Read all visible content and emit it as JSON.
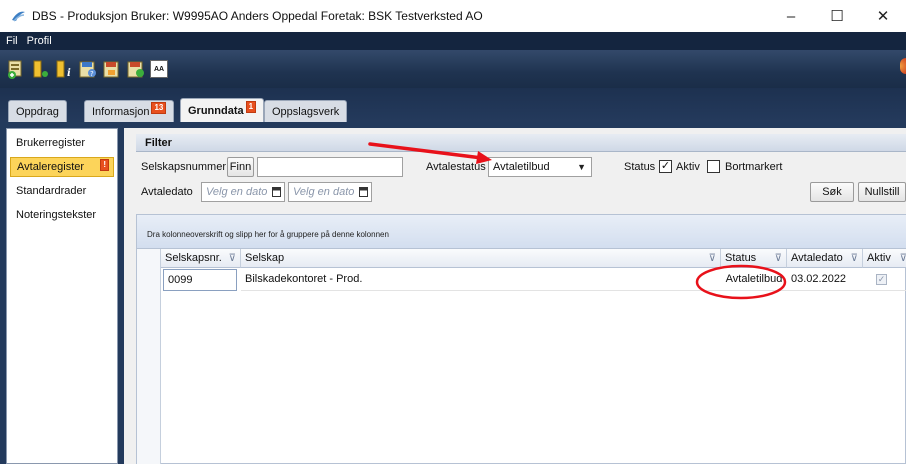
{
  "window": {
    "title": "DBS - Produksjon Bruker: W9995AO Anders Oppedal Foretak: BSK Testverksted AO",
    "minimize_glyph": "–",
    "maximize_glyph": "☐",
    "close_glyph": "✕"
  },
  "menu": {
    "items": [
      "Fil",
      "Profil"
    ]
  },
  "toolbar": {
    "icons": [
      "add-record-icon",
      "save-record-icon",
      "info-icon",
      "help-document-icon",
      "export-icon",
      "import-icon",
      "font-size-icon"
    ],
    "font_icon_label": "AA"
  },
  "tabs": [
    {
      "label": "Oppdrag",
      "badge": ""
    },
    {
      "label": "Informasjon",
      "badge": "13"
    },
    {
      "label": "Grunndata",
      "badge": "1",
      "active": true
    },
    {
      "label": "Oppslagsverk",
      "badge": ""
    }
  ],
  "sidebar": {
    "items": [
      {
        "label": "Brukerregister",
        "badge": ""
      },
      {
        "label": "Avtaleregister",
        "badge": "!",
        "active": true
      },
      {
        "label": "Standardrader",
        "badge": ""
      },
      {
        "label": "Noteringstekster",
        "badge": ""
      }
    ]
  },
  "filter": {
    "title": "Filter",
    "company_number_label": "Selskapsnummer",
    "find_button": "Finn",
    "company_number_value": "",
    "agreement_status_label": "Avtalestatus",
    "agreement_status_value": "Avtaletilbud",
    "status_label": "Status",
    "active_label": "Aktiv",
    "active_checked": true,
    "marked_label": "Bortmarkert",
    "marked_checked": false,
    "agreement_date_label": "Avtaledato",
    "date_from_placeholder": "Velg en dato",
    "date_to_placeholder": "Velg en dato",
    "search_button": "Søk",
    "reset_button": "Nullstill"
  },
  "grid": {
    "group_hint": "Dra kolonneoverskrift og slipp her for å gruppere på denne kolonnen",
    "columns": [
      "Selskapsnr.",
      "Selskap",
      "Status",
      "Avtaledato",
      "Aktiv"
    ],
    "rows": [
      {
        "selskapsnr": "0099",
        "selskap": "Bilskadekontoret - Prod.",
        "status": "Avtaletilbud",
        "avtaledato": "03.02.2022",
        "aktiv": true
      }
    ]
  },
  "annotations": {
    "color": "#e8111a"
  }
}
